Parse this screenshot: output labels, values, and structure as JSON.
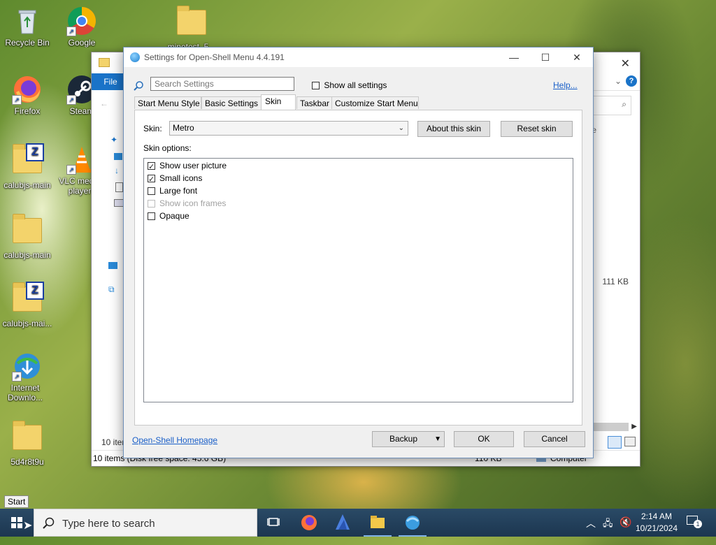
{
  "desktop": {
    "icons": [
      {
        "label": "Recycle Bin"
      },
      {
        "label": "Google Chrome"
      },
      {
        "label": "minetest_5..."
      },
      {
        "label": "Firefox"
      },
      {
        "label": "Steam"
      },
      {
        "label": "calubjs-main"
      },
      {
        "label": "VLC media player"
      },
      {
        "label": "calubjs-main"
      },
      {
        "label": "calubjs-mai..."
      },
      {
        "label": "Internet Downlo..."
      },
      {
        "label": "5d4r8t9u"
      }
    ]
  },
  "explorer": {
    "file_tab": "File",
    "item_count": "10 items",
    "status": "10 items (Disk free space: 45.6 GB)",
    "size_right": "111 KB",
    "size_status": "110 KB",
    "computer_label": "Computer"
  },
  "dialog": {
    "title": "Settings for Open-Shell Menu 4.4.191",
    "search_placeholder": "Search Settings",
    "show_all_label": "Show all settings",
    "help_label": "Help...",
    "tabs": [
      {
        "label": "Start Menu Style"
      },
      {
        "label": "Basic Settings"
      },
      {
        "label": "Skin"
      },
      {
        "label": "Taskbar"
      },
      {
        "label": "Customize Start Menu"
      }
    ],
    "skin_label": "Skin:",
    "skin_value": "Metro",
    "about_skin_label": "About this skin",
    "reset_skin_label": "Reset skin",
    "skin_options_label": "Skin options:",
    "options": [
      {
        "label": "Show user picture",
        "checked": true,
        "enabled": true
      },
      {
        "label": "Small icons",
        "checked": true,
        "enabled": true
      },
      {
        "label": "Large font",
        "checked": false,
        "enabled": true
      },
      {
        "label": "Show icon frames",
        "checked": false,
        "enabled": false
      },
      {
        "label": "Opaque",
        "checked": false,
        "enabled": true
      }
    ],
    "homepage_label": "Open-Shell Homepage",
    "backup_label": "Backup",
    "ok_label": "OK",
    "cancel_label": "Cancel"
  },
  "taskbar": {
    "tooltip": "Start",
    "search_placeholder": "Type here to search",
    "time": "2:14 AM",
    "date": "10/21/2024",
    "notification_count": "1"
  }
}
